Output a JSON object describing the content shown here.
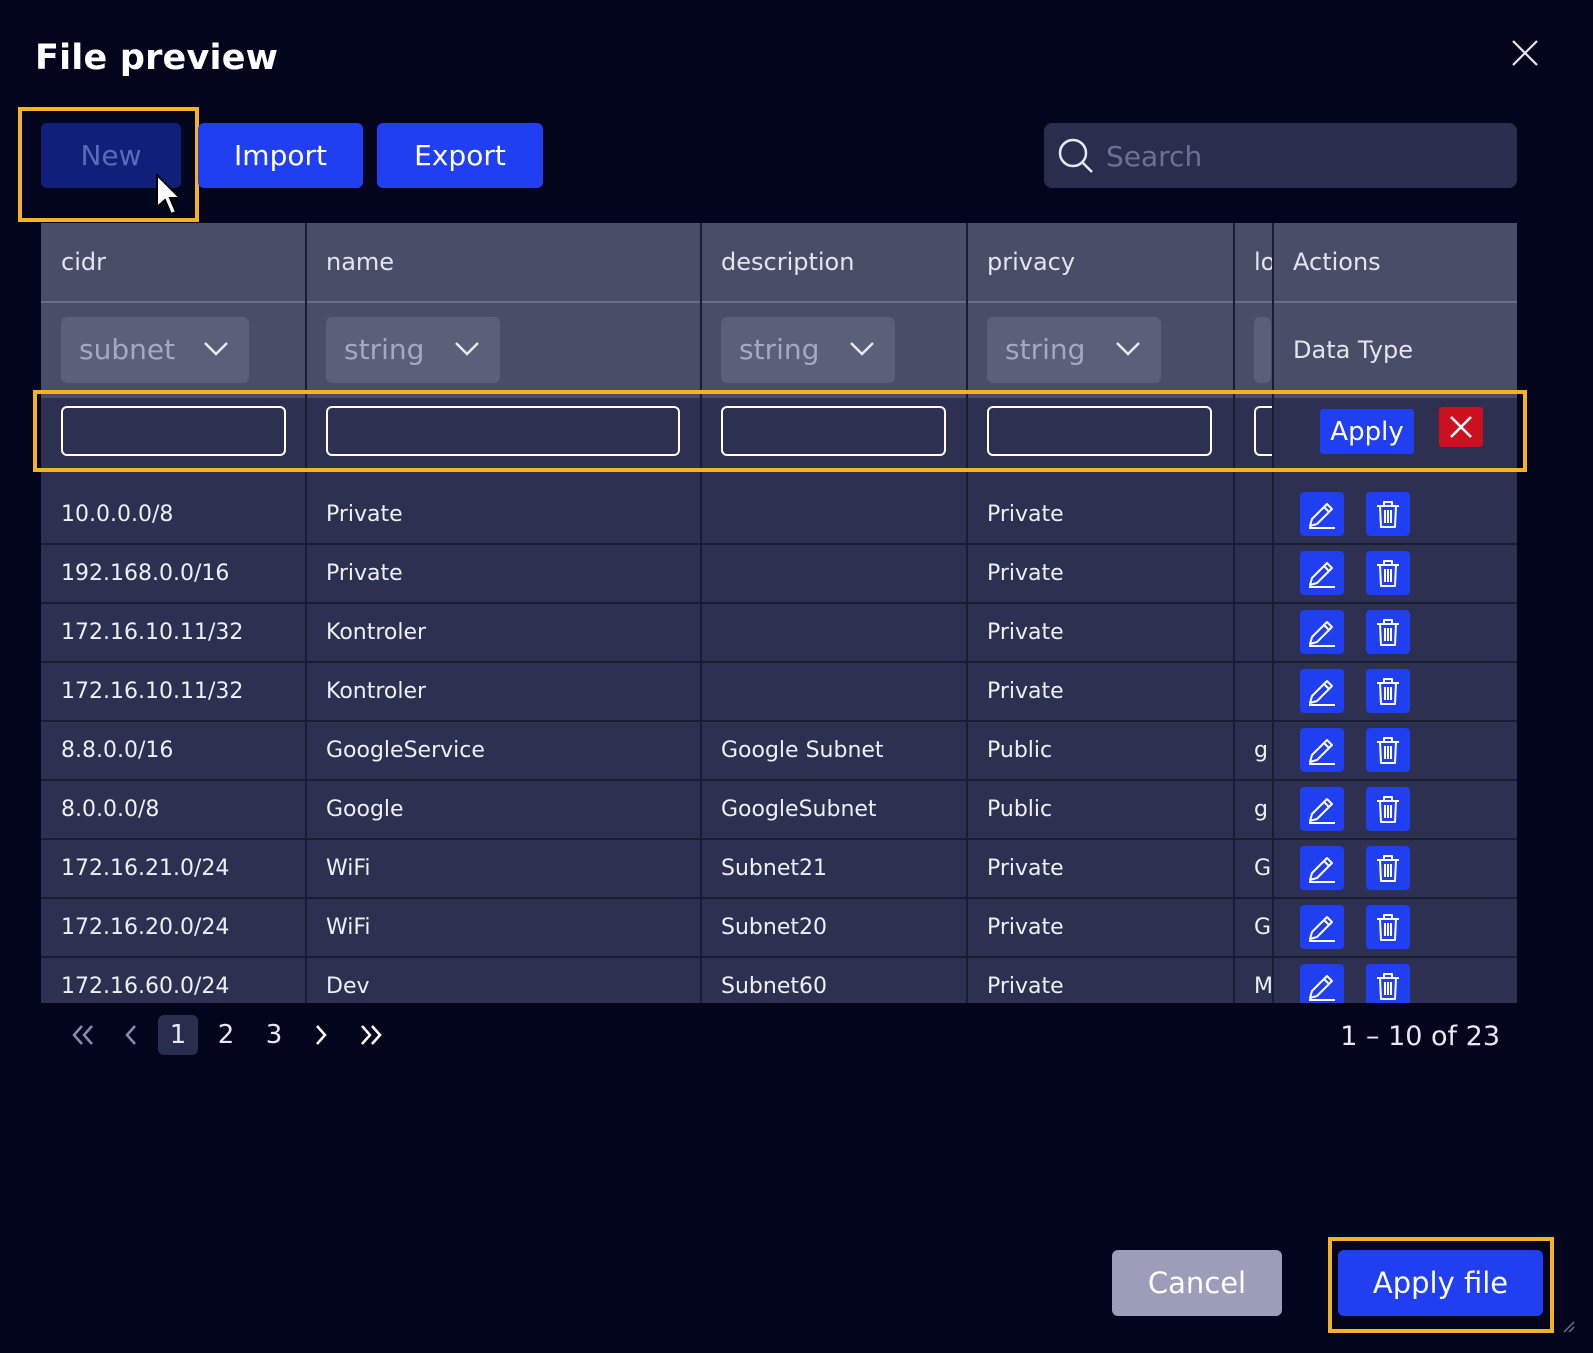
{
  "dialog": {
    "title": "File preview"
  },
  "toolbar": {
    "new_label": "New",
    "import_label": "Import",
    "export_label": "Export"
  },
  "search": {
    "placeholder": "Search"
  },
  "table": {
    "columns": [
      "cidr",
      "name",
      "description",
      "privacy",
      "lo",
      "Actions"
    ],
    "types": [
      "subnet",
      "string",
      "string",
      "string"
    ],
    "actions_subheader": "Data Type",
    "filter_apply_label": "Apply",
    "rows": [
      {
        "cidr": "10.0.0.0/8",
        "name": "Private",
        "description": "",
        "privacy": "Private",
        "lo": ""
      },
      {
        "cidr": "192.168.0.0/16",
        "name": "Private",
        "description": "",
        "privacy": "Private",
        "lo": ""
      },
      {
        "cidr": "172.16.10.11/32",
        "name": "Kontroler",
        "description": "",
        "privacy": "Private",
        "lo": ""
      },
      {
        "cidr": "172.16.10.11/32",
        "name": "Kontroler",
        "description": "",
        "privacy": "Private",
        "lo": ""
      },
      {
        "cidr": "8.8.0.0/16",
        "name": "GoogleService",
        "description": "Google Subnet",
        "privacy": "Public",
        "lo": "g"
      },
      {
        "cidr": "8.0.0.0/8",
        "name": "Google",
        "description": "GoogleSubnet",
        "privacy": "Public",
        "lo": "g"
      },
      {
        "cidr": "172.16.21.0/24",
        "name": "WiFi",
        "description": "Subnet21",
        "privacy": "Private",
        "lo": "G"
      },
      {
        "cidr": "172.16.20.0/24",
        "name": "WiFi",
        "description": "Subnet20",
        "privacy": "Private",
        "lo": "G"
      },
      {
        "cidr": "172.16.60.0/24",
        "name": "Dev",
        "description": "Subnet60",
        "privacy": "Private",
        "lo": "M"
      }
    ]
  },
  "pagination": {
    "first": "«",
    "prev": "‹",
    "pages": [
      "1",
      "2",
      "3"
    ],
    "active_page": "1",
    "next": "›",
    "last": "»",
    "range": "1 – 10 of 23"
  },
  "footer": {
    "cancel_label": "Cancel",
    "apply_file_label": "Apply file"
  },
  "colors": {
    "accent": "#1f3ff0",
    "danger": "#cc1020",
    "highlight": "#f5b321",
    "background": "#03051c"
  }
}
